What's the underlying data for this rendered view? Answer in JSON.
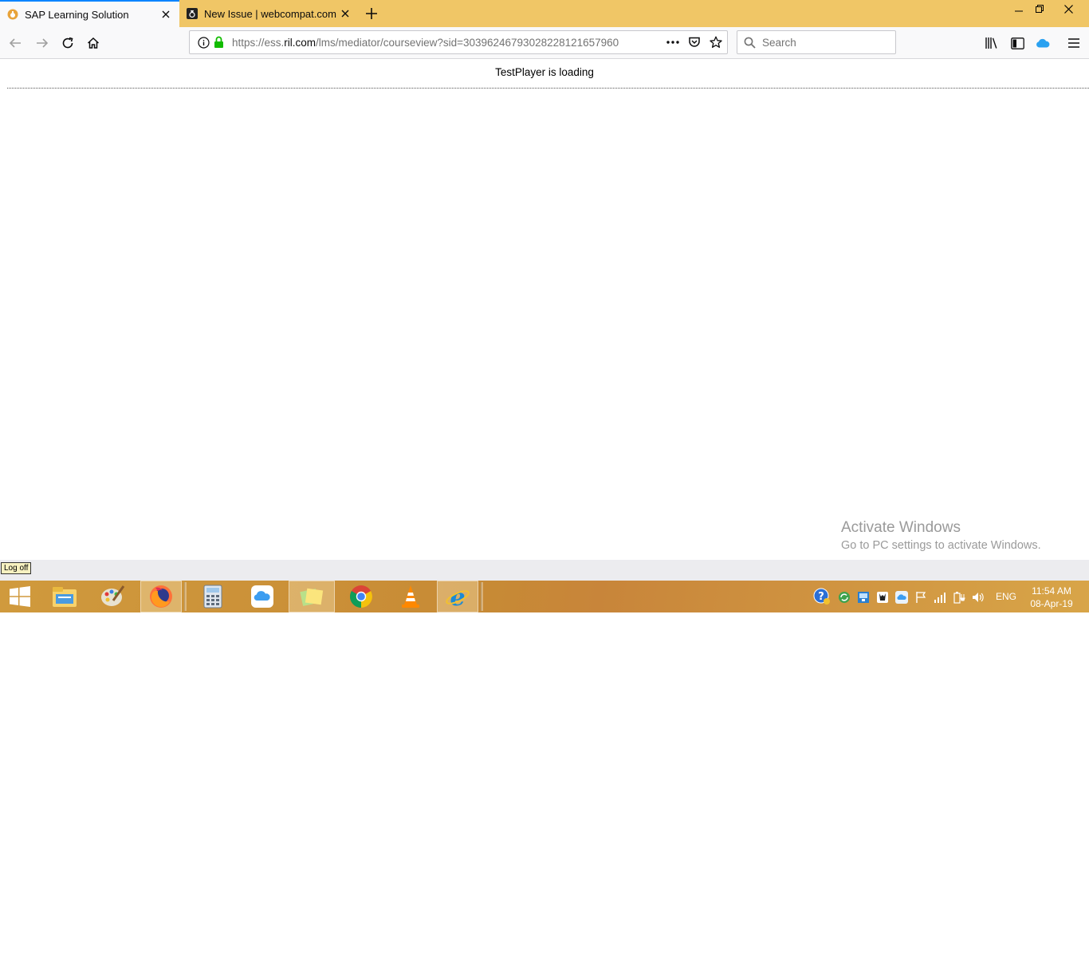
{
  "browser": {
    "tabs": [
      {
        "title": "SAP Learning Solution",
        "active": true
      },
      {
        "title": "New Issue | webcompat.com",
        "active": false
      }
    ],
    "url": {
      "prefix": "https://ess.",
      "host": "ril.com",
      "path": "/lms/mediator/courseview?sid=30396246793028228121657960"
    },
    "search_placeholder": "Search"
  },
  "page": {
    "loading_text": "TestPlayer is loading",
    "watermark_title": "Activate Windows",
    "watermark_subtitle": "Go to PC settings to activate Windows.",
    "logoff_label": "Log off"
  },
  "taskbar": {
    "lang": "ENG",
    "time": "11:54 AM",
    "date": "08-Apr-19"
  },
  "colors": {
    "accent": "#0a84ff",
    "tabbar": "#f0c666",
    "taskbar": "#c8883a"
  }
}
